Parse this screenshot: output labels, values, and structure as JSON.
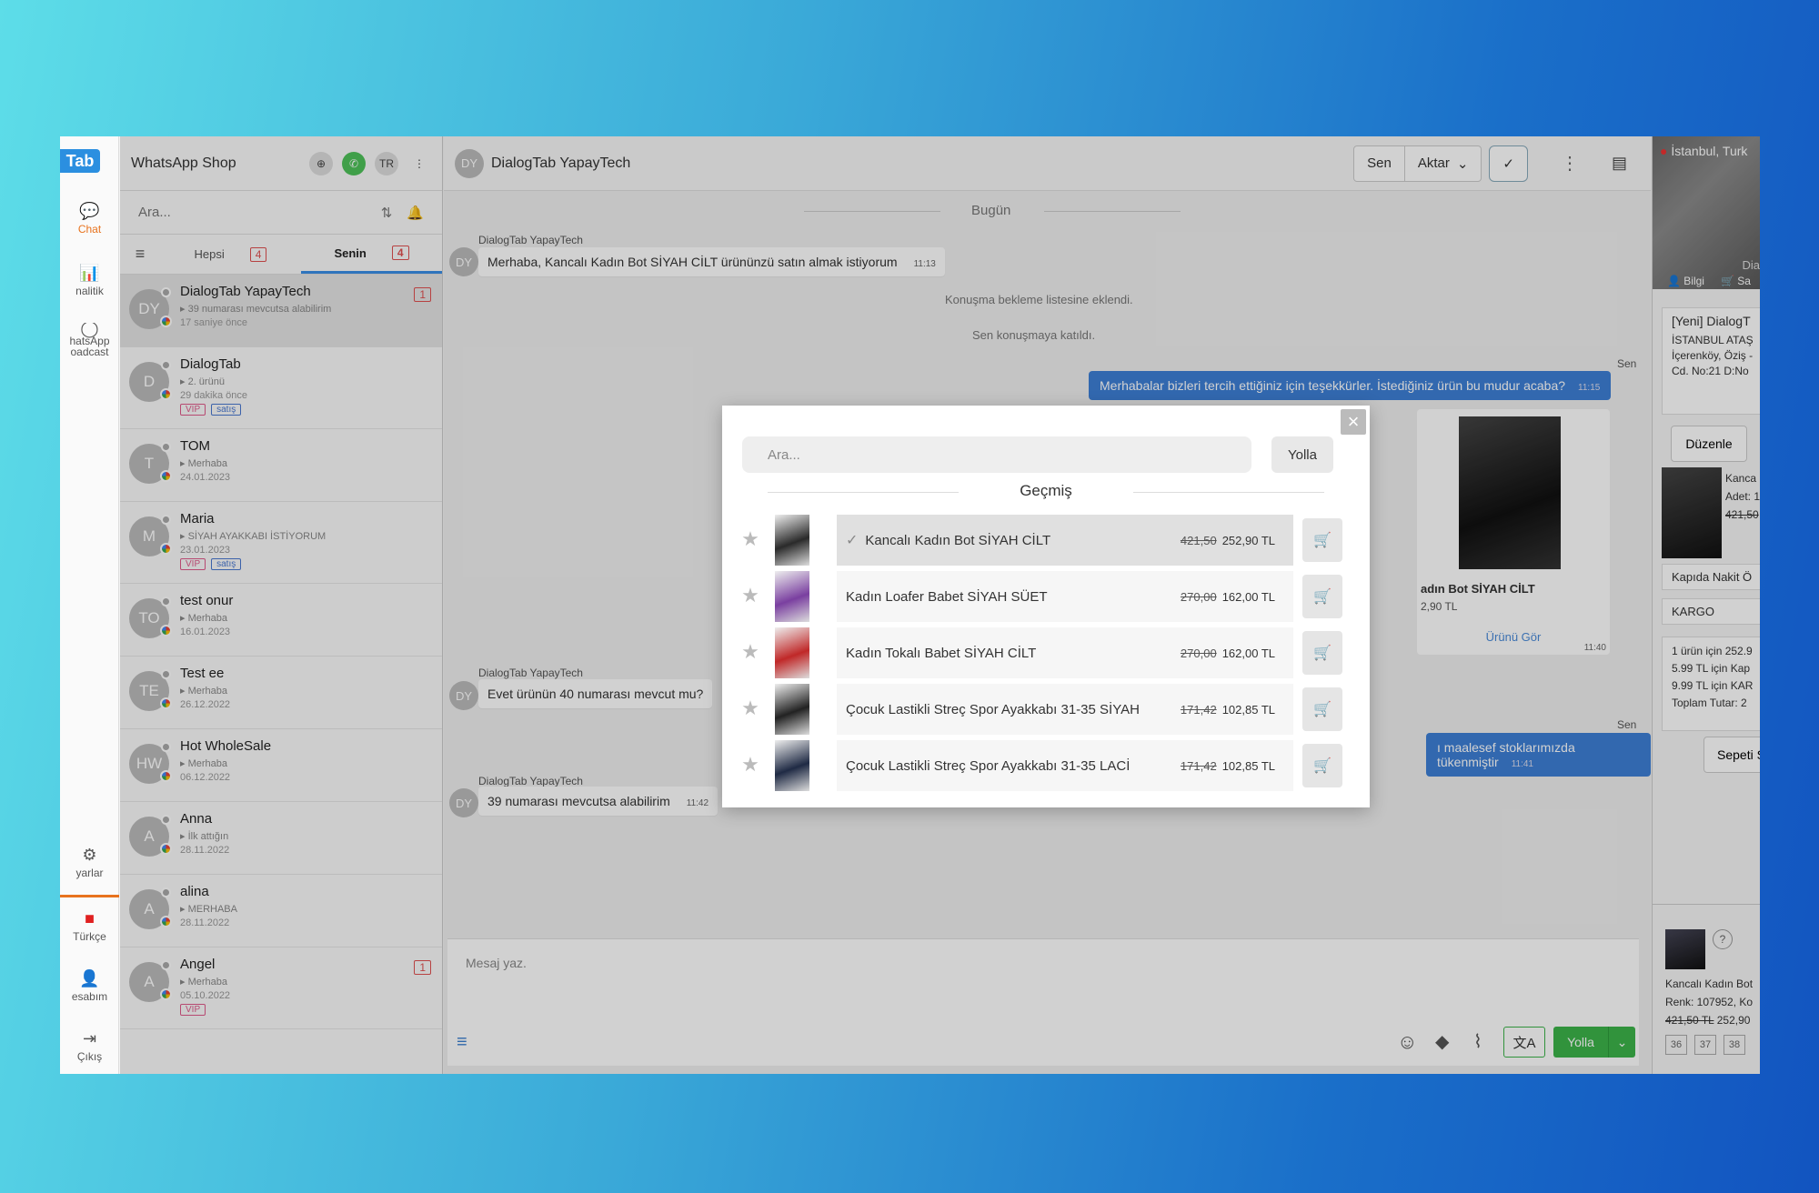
{
  "rail": {
    "logo": "Tab",
    "items": [
      {
        "label": "Chat",
        "icon": "chat-bubble-icon"
      },
      {
        "label": "nalitik",
        "icon": "bar-chart-icon"
      },
      {
        "label": "hatsApp",
        "label2": "oadcast",
        "icon": "whatsapp-icon"
      },
      {
        "label": "yarlar",
        "icon": "gear-icon"
      },
      {
        "label": "Türkçe",
        "icon": "turkey-flag-icon"
      },
      {
        "label": "esabım",
        "icon": "user-icon"
      },
      {
        "label": "Çıkış",
        "icon": "logout-icon"
      }
    ]
  },
  "list": {
    "title": "WhatsApp Shop",
    "lang": "TR",
    "search_placeholder": "Ara...",
    "tabs": [
      {
        "label": "Hepsi",
        "count": "4"
      },
      {
        "label": "Senin",
        "count": "4"
      }
    ],
    "conversations": [
      {
        "initials": "DY",
        "name": "DialogTab YapayTech",
        "msg": "▸ 39 numarası mevcutsa alabilirim",
        "date": "17 saniye önce",
        "badge": "1",
        "tags": []
      },
      {
        "initials": "D",
        "name": "DialogTab",
        "msg": "▸ 2. ürünü",
        "date": "29 dakika önce",
        "badge": "",
        "tags": [
          "VIP",
          "satış"
        ]
      },
      {
        "initials": "T",
        "name": "TOM",
        "msg": "▸ Merhaba",
        "date": "24.01.2023",
        "badge": "",
        "tags": []
      },
      {
        "initials": "M",
        "name": "Maria",
        "msg": "▸ SİYAH AYAKKABI İSTİYORUM",
        "date": "23.01.2023",
        "badge": "",
        "tags": [
          "VIP",
          "satış"
        ]
      },
      {
        "initials": "TO",
        "name": "test onur",
        "msg": "▸ Merhaba",
        "date": "16.01.2023",
        "badge": "",
        "tags": []
      },
      {
        "initials": "TE",
        "name": "Test ee",
        "msg": "▸ Merhaba",
        "date": "26.12.2022",
        "badge": "",
        "tags": []
      },
      {
        "initials": "HW",
        "name": "Hot WholeSale",
        "msg": "▸ Merhaba",
        "date": "06.12.2022",
        "badge": "",
        "tags": []
      },
      {
        "initials": "A",
        "name": "Anna",
        "msg": "▸ İlk attığın",
        "date": "28.11.2022",
        "badge": "",
        "tags": []
      },
      {
        "initials": "A",
        "name": "alina",
        "msg": "▸ MERHABA",
        "date": "28.11.2022",
        "badge": "",
        "tags": []
      },
      {
        "initials": "A",
        "name": "Angel",
        "msg": "▸ Merhaba",
        "date": "05.10.2022",
        "badge": "1",
        "tags": [
          "VIP"
        ]
      }
    ]
  },
  "chat": {
    "initials": "DY",
    "title": "DialogTab YapayTech",
    "btn_sen": "Sen",
    "btn_aktar": "Aktar",
    "day": "Bugün",
    "sender": "DialogTab YapayTech",
    "you": "Sen",
    "msg1": "Merhaba, Kancalı Kadın Bot SİYAH CİLT ürününzü satın almak istiyorum",
    "msg1_time": "11:13",
    "sys1": "Konuşma bekleme listesine eklendi.",
    "sys2": "Sen konuşmaya katıldı.",
    "out1": "Merhabalar bizleri tercih ettiğiniz için teşekkürler. İstediğiniz ürün bu mudur acaba?",
    "out1_time": "11:15",
    "card_name": "adın Bot SİYAH CİLT",
    "card_price": "2,90 TL",
    "card_link": "Ürünü Gör",
    "card_time": "11:40",
    "msg2": "Evet ürünün 40 numarası mevcut mu?",
    "out2": "ı maalesef stoklarımızda tükenmiştir",
    "out2_time": "11:41",
    "msg3": "39 numarası mevcutsa alabilirim",
    "msg3_time": "11:42",
    "composer_placeholder": "Mesaj yaz.",
    "send_label": "Yolla"
  },
  "right": {
    "location": "İstanbul, Turk",
    "map_label": "Dia",
    "tab_info": "Bilgi",
    "tab_sa": "Sa",
    "addr_title": "[Yeni] DialogT",
    "addr1": "İSTANBUL ATAŞ",
    "addr2": "İçerenköy, Öziş -",
    "addr3": "Cd. No:21 D:No",
    "edit": "Düzenle",
    "item_name": "Kanca",
    "item_qty": "Adet: 1",
    "item_old": "421,50",
    "payment": "Kapıda Nakit Ö",
    "shipping": "KARGO",
    "sum1": "1 ürün için 252.9",
    "sum2": "5.99 TL için Kap",
    "sum3": "9.99 TL için KAR",
    "sum4": "Toplam Tutar: 2",
    "cart_btn": "Sepeti S",
    "prod_name": "Kancalı Kadın Bot",
    "prod_color": "Renk: 107952, Ko",
    "prod_old": "421,50 TL",
    "prod_new": "252,90",
    "sizes": [
      "36",
      "37",
      "38"
    ]
  },
  "modal": {
    "search_placeholder": "Ara...",
    "send": "Yolla",
    "title": "Geçmiş",
    "products": [
      {
        "name": "Kancalı Kadın Bot SİYAH CİLT",
        "old": "421,50",
        "price": "252,90 TL",
        "selected": true,
        "color": "#2a2a2a"
      },
      {
        "name": "Kadın Loafer Babet SİYAH SÜET",
        "old": "270,00",
        "price": "162,00 TL",
        "selected": false,
        "color": "#7a3fa0"
      },
      {
        "name": "Kadın Tokalı Babet SİYAH CİLT",
        "old": "270,00",
        "price": "162,00 TL",
        "selected": false,
        "color": "#c02828"
      },
      {
        "name": "Çocuk Lastikli Streç Spor Ayakkabı 31-35 SİYAH",
        "old": "171,42",
        "price": "102,85 TL",
        "selected": false,
        "color": "#222222"
      },
      {
        "name": "Çocuk Lastikli Streç Spor Ayakkabı 31-35 LACİ",
        "old": "171,42",
        "price": "102,85 TL",
        "selected": false,
        "color": "#1f2a44"
      }
    ]
  }
}
